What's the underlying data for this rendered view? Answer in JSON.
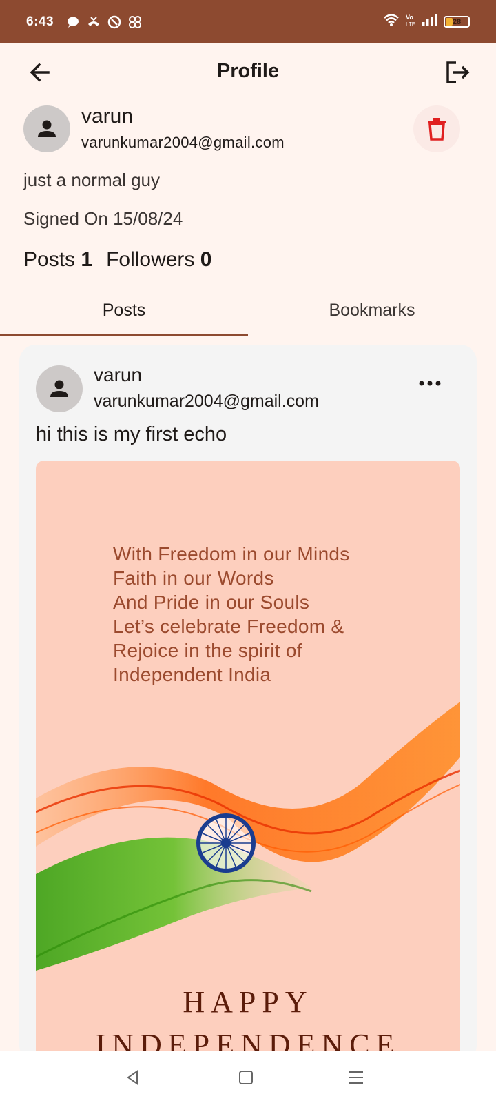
{
  "status_bar": {
    "time": "6:43",
    "battery": "28",
    "battery_level": 0.28
  },
  "app_bar": {
    "title": "Profile",
    "back_icon": "arrow-left-icon",
    "logout_icon": "logout-icon"
  },
  "profile": {
    "name": "varun",
    "email": "varunkumar2004@gmail.com",
    "bio": "just a normal guy",
    "signed_on": "Signed On 15/08/24",
    "posts_label": "Posts",
    "posts_count": "1",
    "followers_label": "Followers",
    "followers_count": "0",
    "delete_icon": "trash-icon"
  },
  "tabs": [
    {
      "label": "Posts",
      "active": true
    },
    {
      "label": "Bookmarks",
      "active": false
    }
  ],
  "post": {
    "name": "varun",
    "email": "varunkumar2004@gmail.com",
    "text": "hi this is my first echo",
    "image": {
      "lines": [
        "With Freedom in our Minds",
        "Faith in our Words",
        "And Pride in our Souls",
        "Let’s celebrate Freedom &",
        "Rejoice in the spirit of",
        "Independent India"
      ],
      "happy": "HAPPY",
      "independence": "INDEPENDENCE"
    }
  },
  "colors": {
    "accent": "#8d4a30",
    "background": "#fff4ef",
    "card": "#f4f4f4",
    "delete": "#e02020"
  }
}
